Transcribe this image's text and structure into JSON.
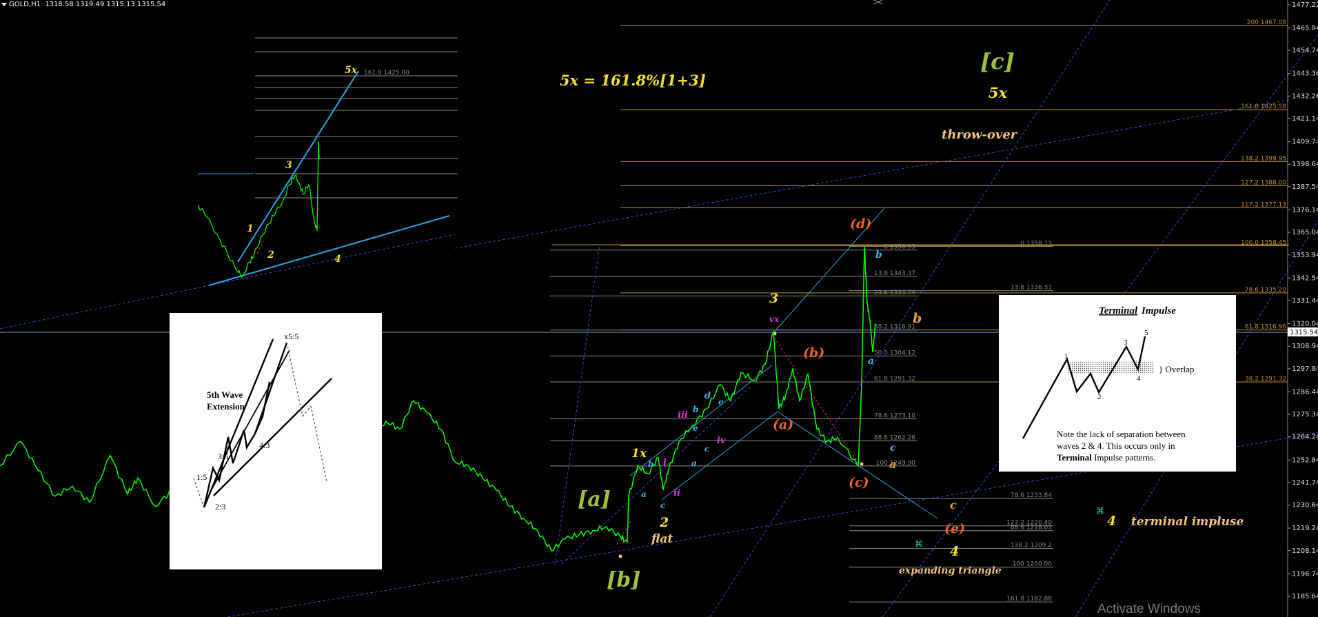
{
  "header": {
    "symbol": "GOLD,H1",
    "ohlc": "1318.58 1319.49 1315.13 1315.54"
  },
  "current_price": "1315.54",
  "watermark": "Activate Windows",
  "colors": {
    "price": "#00ff00",
    "fib_gold": "#c8922a",
    "fib_gray": "#8a8a8a",
    "channel": "#2e4cd0",
    "trend": "#2aa6e8",
    "yellow": "#f3e12b",
    "orange": "#f06424",
    "olive": "#9cc23a",
    "magenta": "#e03ce0",
    "cyan": "#39b6ea"
  },
  "chart_data": {
    "type": "line",
    "series": [
      {
        "name": "",
        "points": [
          [
            0,
            1250
          ],
          [
            30,
            1262
          ],
          [
            55,
            1248
          ],
          [
            80,
            1235
          ],
          [
            105,
            1240
          ],
          [
            130,
            1232
          ],
          [
            160,
            1255
          ],
          [
            185,
            1236
          ],
          [
            200,
            1244
          ],
          [
            225,
            1230
          ],
          [
            250,
            1238
          ],
          [
            275,
            1235
          ],
          [
            300,
            1247
          ],
          [
            330,
            1238
          ],
          [
            355,
            1246
          ],
          [
            380,
            1232
          ],
          [
            400,
            1252
          ],
          [
            420,
            1252
          ],
          [
            440,
            1255
          ],
          [
            460,
            1260
          ],
          [
            480,
            1248
          ],
          [
            500,
            1262
          ],
          [
            520,
            1258
          ],
          [
            540,
            1265
          ],
          [
            560,
            1272
          ],
          [
            580,
            1268
          ],
          [
            600,
            1282
          ],
          [
            620,
            1276
          ],
          [
            640,
            1268
          ],
          [
            660,
            1252
          ],
          [
            680,
            1250
          ],
          [
            700,
            1244
          ],
          [
            720,
            1238
          ],
          [
            740,
            1230
          ],
          [
            760,
            1224
          ],
          [
            780,
            1218
          ],
          [
            800,
            1208
          ],
          [
            820,
            1214
          ],
          [
            840,
            1216
          ],
          [
            860,
            1218
          ],
          [
            880,
            1220
          ],
          [
            900,
            1215
          ],
          [
            910,
            1212
          ],
          [
            912,
            1235
          ],
          [
            925,
            1250
          ],
          [
            940,
            1246
          ],
          [
            955,
            1254
          ],
          [
            962,
            1238
          ],
          [
            970,
            1248
          ],
          [
            985,
            1262
          ],
          [
            1005,
            1270
          ],
          [
            1025,
            1278
          ],
          [
            1045,
            1290
          ],
          [
            1060,
            1282
          ],
          [
            1075,
            1296
          ],
          [
            1095,
            1292
          ],
          [
            1110,
            1300
          ],
          [
            1122,
            1316
          ],
          [
            1130,
            1278
          ],
          [
            1140,
            1285
          ],
          [
            1150,
            1298
          ],
          [
            1160,
            1282
          ],
          [
            1172,
            1295
          ],
          [
            1185,
            1268
          ],
          [
            1200,
            1262
          ],
          [
            1215,
            1264
          ],
          [
            1245,
            1250
          ],
          [
            1250,
            1290
          ],
          [
            1254,
            1358
          ],
          [
            1258,
            1330
          ],
          [
            1262,
            1322
          ],
          [
            1266,
            1306
          ],
          [
            1270,
            1320
          ]
        ]
      }
    ],
    "y_ticks": [
      "1477.22",
      "1465.84",
      "1454.74",
      "1443.36",
      "1432.26",
      "1421.14",
      "1409.74",
      "1398.64",
      "1387.54",
      "1376.14",
      "1365.04",
      "1353.94",
      "1342.54",
      "1331.44",
      "1320.04",
      "1308.94",
      "1297.84",
      "1286.44",
      "1275.34",
      "1264.24",
      "1252.84",
      "1241.74",
      "1230.64",
      "1219.24",
      "1208.14",
      "1196.74",
      "1185.64"
    ],
    "fib_gold": [
      "200 1467.08",
      "161.8 1425.58",
      "138.2 1399.95",
      "127.2 1388.00",
      "117.2 1377.13",
      "100.0 1358.45",
      "78.6 1335.20",
      "61.8 1316.96",
      "38.2 1291.32"
    ],
    "fib_gray_a": [
      "0 1356.33",
      "13.8 1343.37",
      "23.6 1333.74",
      "38.2 1316.91",
      "50.0 1304.12",
      "61.8 1291.32",
      "78.6 1273.10",
      "88.6 1262.26",
      "100 1249.90"
    ],
    "fib_gray_b": [
      "0 1358.13",
      "13.8 1336.31",
      "78.6 1233.84",
      "127.2 1220.40",
      "88.6 1218.03",
      "138.2 1209.2",
      "100 1200.00",
      "161.8 1182.88"
    ],
    "inset_fib_label": "161.8 1425.00"
  },
  "annotations": {
    "formula": "5x = 161.8%[1+3]",
    "c_big": "[c]",
    "five_x_big": "5x",
    "throw_over": "throw-over",
    "d": "(d)",
    "three": "3",
    "vx": "vx",
    "b_paren": "(b)",
    "a_paren": "(a)",
    "c_paren": "(c)",
    "e_paren": "(e)",
    "b_blue": "b",
    "a_blue": "a",
    "c_blue": "c",
    "a_orange": "a",
    "b_orange": "b",
    "c_orange": "c",
    "four": "4",
    "expanding_triangle": "expanding triangle",
    "one_x": "1x",
    "two": "2",
    "flat": "flat",
    "a_sq": "[a]",
    "b_sq": "[b]",
    "iii": "iii",
    "i": "i",
    "ii": "ii",
    "iv": "iv",
    "bl_a1": "a",
    "bl_b1": "b",
    "bl_c1": "c",
    "bl_d1": "d",
    "bl_b2": "b",
    "bl_c2": "c",
    "bl_a2": "a",
    "bl_e1": "e",
    "bl_e2": "e",
    "four_ti": "4",
    "terminal_impulse": "terminal impluse",
    "ti_star": "⌘",
    "blue_star": "⌘",
    "inset_5x": "5x",
    "inset_1": "1",
    "inset_2": "2",
    "inset_3": "3",
    "inset_4": "4"
  },
  "inset_5th": {
    "title": "5th Wave",
    "title2": "Extension",
    "l15": "1:5",
    "l23": "2:3",
    "l35": "3:5",
    "l43": "4:3",
    "lx55": "x5:5"
  },
  "inset_terminal": {
    "title_a": "Terminal",
    "title_b": " Impulse",
    "n1": "1",
    "n2": "2",
    "n3": "3",
    "n4": "4",
    "n5": "5",
    "overlap": "} Overlap",
    "note1": "Note the lack of separation between",
    "note2": "waves 2 & 4.  This occurs only in",
    "note3b": "Terminal",
    "note3r": " Impulse patterns."
  }
}
